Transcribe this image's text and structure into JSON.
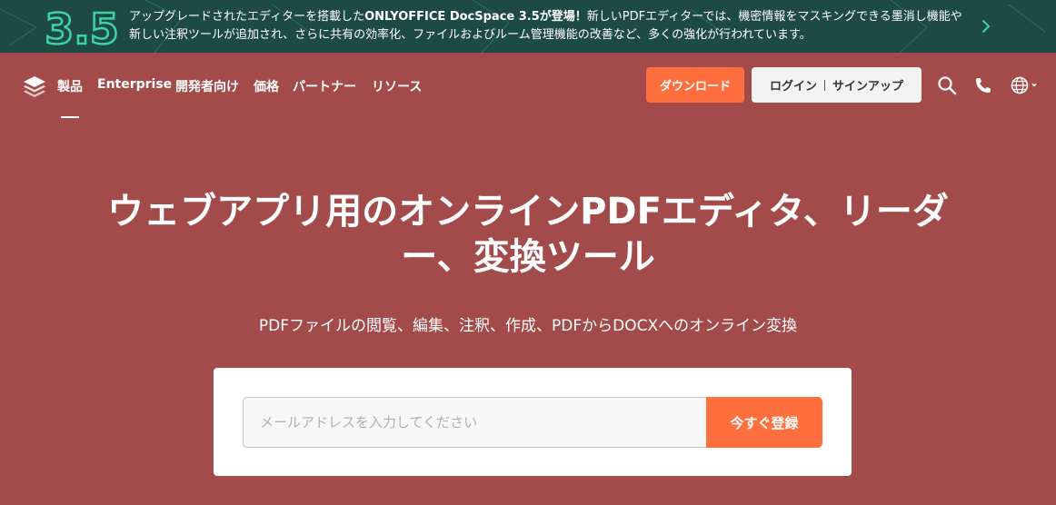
{
  "promo": {
    "badge_text": "3.5",
    "text_before": "アップグレードされたエディターを搭載した",
    "text_bold": "ONLYOFFICE DocSpace 3.5が登場！",
    "text_after": "新しいPDFエディターでは、機密情報をマスキングできる墨消し機能や新しい注釈ツールが追加され、さらに共有の効率化、ファイルおよびルーム管理機能の改善など、多くの強化が行われています。",
    "arrow_icon": "chevron-right-icon"
  },
  "nav": {
    "logo_icon": "layers-logo-icon",
    "items": [
      "製品",
      "Enterprise",
      "開発者向け",
      "価格",
      "パートナー",
      "リソース"
    ],
    "download_label": "ダウンロード",
    "login_label": "ログイン",
    "signup_label": "サインアップ",
    "icons": [
      "search-icon",
      "phone-icon",
      "globe-icon"
    ]
  },
  "hero": {
    "title_line1": "ウェブアプリ用のオンラインPDFエディタ、リーダ",
    "title_line2": "ー、変換ツール",
    "subtitle": "PDFファイルの閲覧、編集、注釈、作成、PDFからDOCXへのオンライン変換"
  },
  "signup": {
    "email_placeholder": "メールアドレスを入力してください",
    "email_value": "",
    "button_label": "今すぐ登録"
  },
  "colors": {
    "background": "#a34b4b",
    "promo_bg": "#1e4a46",
    "accent": "#ff6f3d",
    "badge_green": "#3fd3a0"
  }
}
